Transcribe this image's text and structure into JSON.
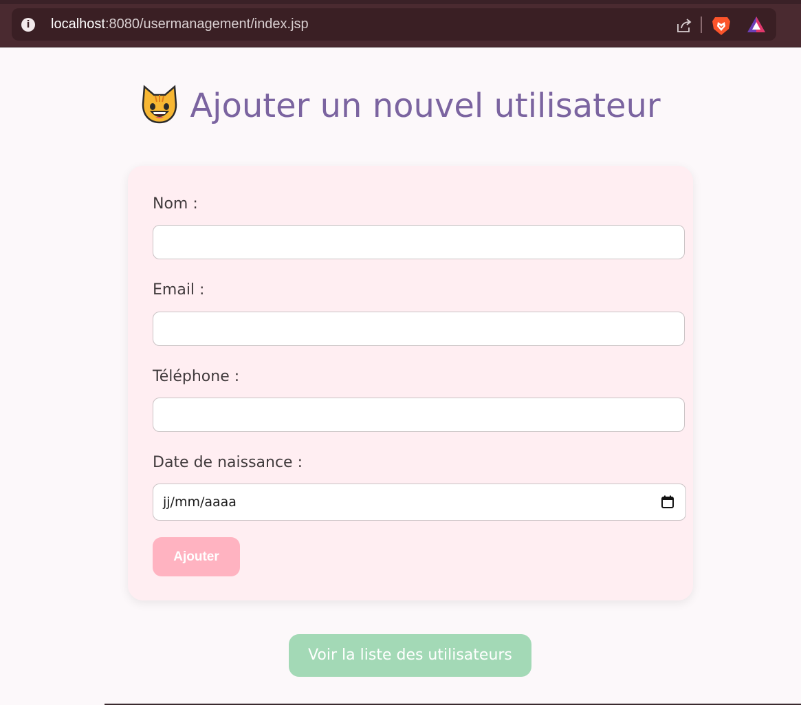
{
  "browser": {
    "url_host": "localhost",
    "url_rest": ":8080/usermanagement/index.jsp",
    "icons": [
      "info-icon",
      "share-icon",
      "brave-lion-icon",
      "triangle-rewards-icon"
    ]
  },
  "page": {
    "title_icon": "smiling-cat-emoji",
    "title": "Ajouter un nouvel utilisateur"
  },
  "form": {
    "fields": [
      {
        "label": "Nom :",
        "value": ""
      },
      {
        "label": "Email :",
        "value": ""
      },
      {
        "label": "Téléphone :",
        "value": ""
      },
      {
        "label": "Date de naissance :",
        "placeholder": "jj/mm/aaaa"
      }
    ],
    "submit_label": "Ajouter"
  },
  "link": {
    "label": "Voir la liste des utilisateurs"
  },
  "colors": {
    "title": "#7b64a0",
    "card_bg": "#ffeef2",
    "submit_bg": "#ffb3c1",
    "link_bg": "#a3d9b6",
    "browser_bar": "#4a2a30"
  }
}
